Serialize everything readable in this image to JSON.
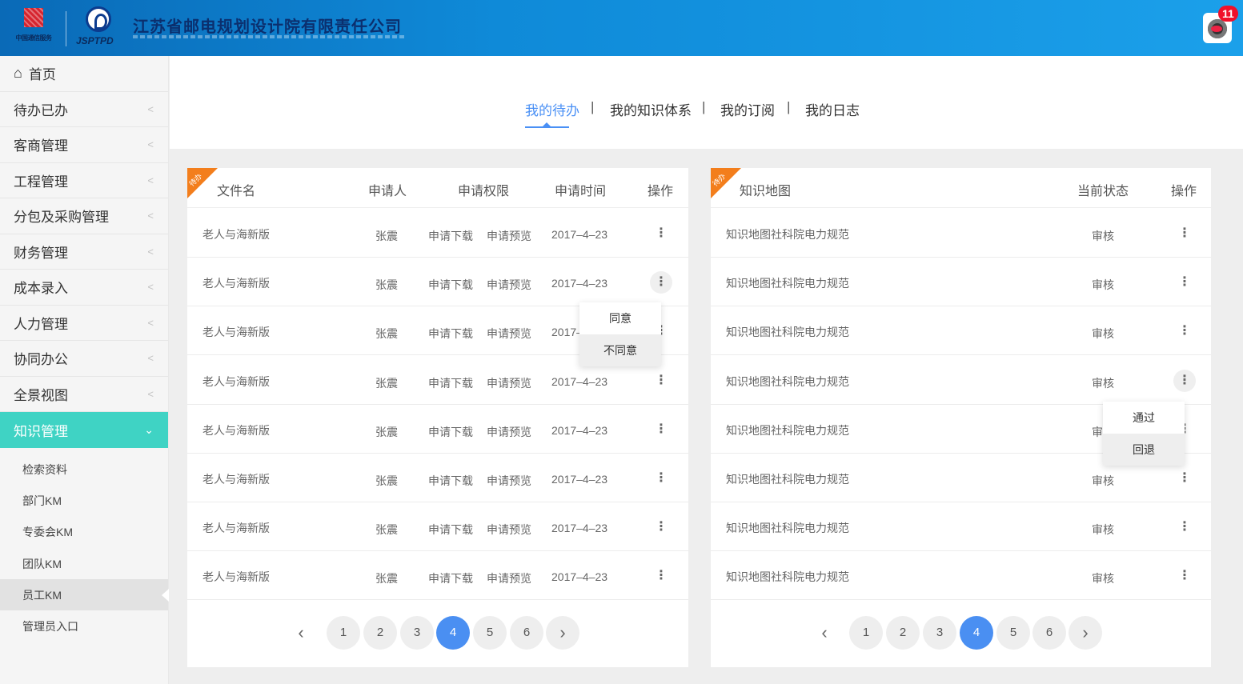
{
  "header": {
    "logo_left_text": "中国通信服务",
    "logo_right_text": "JSPTPD",
    "company_name": "江苏省邮电规划设计院有限责任公司",
    "notification_count": "11"
  },
  "sidebar": {
    "home_label": "首页",
    "items": [
      {
        "label": "待办已办"
      },
      {
        "label": "客商管理"
      },
      {
        "label": "工程管理"
      },
      {
        "label": "分包及采购管理"
      },
      {
        "label": "财务管理"
      },
      {
        "label": "成本录入"
      },
      {
        "label": "人力管理"
      },
      {
        "label": "协同办公"
      },
      {
        "label": "全景视图"
      },
      {
        "label": "知识管理"
      }
    ],
    "sub_items": [
      {
        "label": "检索资料"
      },
      {
        "label": "部门KM"
      },
      {
        "label": "专委会KM"
      },
      {
        "label": "团队KM"
      },
      {
        "label": "员工KM"
      },
      {
        "label": "管理员入口"
      }
    ]
  },
  "tabs": [
    {
      "label": "我的待办"
    },
    {
      "label": "我的知识体系"
    },
    {
      "label": "我的订阅"
    },
    {
      "label": "我的日志"
    }
  ],
  "tab_separator": "|",
  "left_panel": {
    "corner_label": "待办",
    "headers": {
      "file": "文件名",
      "applicant": "申请人",
      "permission": "申请权限",
      "time": "申请时间",
      "action": "操作"
    },
    "rows": [
      {
        "file": "老人与海新版",
        "applicant": "张震",
        "perm1": "申请下载",
        "perm2": "申请预览",
        "time": "2017–4–23"
      },
      {
        "file": "老人与海新版",
        "applicant": "张震",
        "perm1": "申请下载",
        "perm2": "申请预览",
        "time": "2017–4–23"
      },
      {
        "file": "老人与海新版",
        "applicant": "张震",
        "perm1": "申请下载",
        "perm2": "申请预览",
        "time": "2017–"
      },
      {
        "file": "老人与海新版",
        "applicant": "张震",
        "perm1": "申请下载",
        "perm2": "申请预览",
        "time": "2017–4–23"
      },
      {
        "file": "老人与海新版",
        "applicant": "张震",
        "perm1": "申请下载",
        "perm2": "申请预览",
        "time": "2017–4–23"
      },
      {
        "file": "老人与海新版",
        "applicant": "张震",
        "perm1": "申请下载",
        "perm2": "申请预览",
        "time": "2017–4–23"
      },
      {
        "file": "老人与海新版",
        "applicant": "张震",
        "perm1": "申请下载",
        "perm2": "申请预览",
        "time": "2017–4–23"
      },
      {
        "file": "老人与海新版",
        "applicant": "张震",
        "perm1": "申请下载",
        "perm2": "申请预览",
        "time": "2017–4–23"
      }
    ],
    "popup": {
      "agree": "同意",
      "disagree": "不同意"
    },
    "pager": {
      "prev": "‹",
      "pages": [
        "1",
        "2",
        "3",
        "4",
        "5",
        "6"
      ],
      "current": "4",
      "next": "›"
    }
  },
  "right_panel": {
    "corner_label": "待办",
    "headers": {
      "map": "知识地图",
      "status": "当前状态",
      "action": "操作"
    },
    "rows": [
      {
        "map": "知识地图社科院电力规范",
        "status": "审核"
      },
      {
        "map": "知识地图社科院电力规范",
        "status": "审核"
      },
      {
        "map": "知识地图社科院电力规范",
        "status": "审核"
      },
      {
        "map": "知识地图社科院电力规范",
        "status": "审核"
      },
      {
        "map": "知识地图社科院电力规范",
        "status": "审"
      },
      {
        "map": "知识地图社科院电力规范",
        "status": "审核"
      },
      {
        "map": "知识地图社科院电力规范",
        "status": "审核"
      },
      {
        "map": "知识地图社科院电力规范",
        "status": "审核"
      }
    ],
    "popup": {
      "approve": "通过",
      "reject": "回退"
    },
    "pager": {
      "prev": "‹",
      "pages": [
        "1",
        "2",
        "3",
        "4",
        "5",
        "6"
      ],
      "current": "4",
      "next": "›"
    }
  },
  "colors": {
    "accent": "#4a90f5",
    "active_nav": "#3fd3c4",
    "corner": "#f37e1c",
    "badge": "#f0102a"
  },
  "icons": {
    "kebab": "more-vertical-icon",
    "home": "home-icon",
    "chevron": "chevron-left-icon"
  }
}
